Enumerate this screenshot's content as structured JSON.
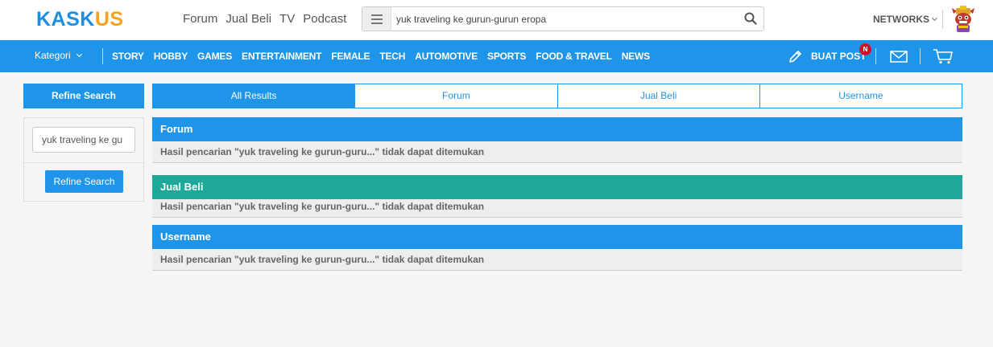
{
  "logo": {
    "part1": "KASK",
    "part2": "US"
  },
  "topnav": {
    "items": [
      "Forum",
      "Jual Beli",
      "TV",
      "Podcast"
    ]
  },
  "search": {
    "value": "yuk traveling ke gurun-gurun eropa"
  },
  "networks": {
    "label": "NETWORKS"
  },
  "catbar": {
    "kategori": "Kategori",
    "items": [
      "STORY",
      "HOBBY",
      "GAMES",
      "ENTERTAINMENT",
      "FEMALE",
      "TECH",
      "AUTOMOTIVE",
      "SPORTS",
      "FOOD & TRAVEL",
      "NEWS"
    ],
    "buat_post": "BUAT POST",
    "badge": "N"
  },
  "refine": {
    "heading": "Refine Search",
    "input_value": "yuk traveling ke gu",
    "button": "Refine Search"
  },
  "tabs": [
    "All Results",
    "Forum",
    "Jual Beli",
    "Username"
  ],
  "sections": [
    {
      "title": "Forum",
      "message": "Hasil pencarian \"yuk traveling ke gurun-guru...\" tidak dapat ditemukan"
    },
    {
      "title": "Jual Beli",
      "message": "Hasil pencarian \"yuk traveling ke gurun-guru...\" tidak dapat ditemukan"
    },
    {
      "title": "Username",
      "message": "Hasil pencarian \"yuk traveling ke gurun-guru...\" tidak dapat ditemukan"
    }
  ],
  "colors": {
    "brand_blue": "#1e95e8",
    "brand_orange": "#f6a21e",
    "jual_beli_teal": "#1ea89a",
    "badge_red": "#d0112b"
  },
  "icons": {
    "search_menu": "hamburger-icon",
    "search": "magnifier-icon",
    "post": "pencil-icon",
    "mail": "envelope-icon",
    "cart": "cart-icon",
    "avatar": "mascot-avatar"
  }
}
